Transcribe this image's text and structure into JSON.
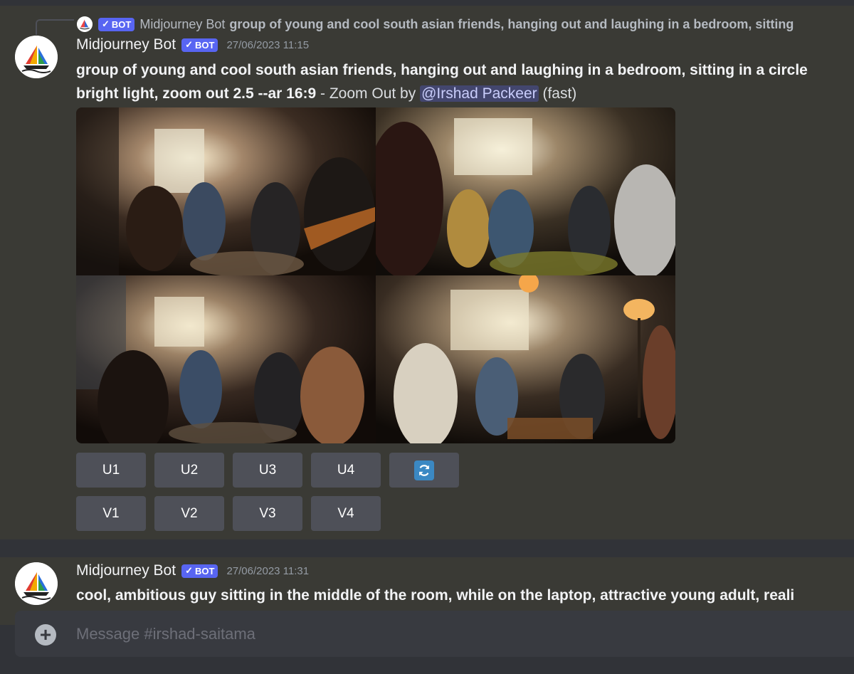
{
  "message1": {
    "reply_author": "Midjourney Bot",
    "reply_badge": "BOT",
    "reply_prompt": "group of young and cool south asian friends, hanging out and laughing in a bedroom, sitting",
    "author": "Midjourney Bot",
    "badge": "BOT",
    "timestamp": "27/06/2023 11:15",
    "prompt_line1": "group of young and cool south asian friends, hanging out and laughing in a bedroom, sitting in a circle",
    "prompt_line2": "bright light, zoom out 2.5 --ar 16:9",
    "suffix_text": " - Zoom Out by ",
    "mention": "@Irshad Packeer",
    "speed": " (fast)",
    "buttons_upscale": [
      "U1",
      "U2",
      "U3",
      "U4"
    ],
    "refresh_icon": "refresh-icon",
    "buttons_variation": [
      "V1",
      "V2",
      "V3",
      "V4"
    ]
  },
  "message2": {
    "author": "Midjourney Bot",
    "badge": "BOT",
    "timestamp": "27/06/2023 11:31",
    "prompt": "cool, ambitious guy sitting in the middle of the room, while on the laptop, attractive young adult, reali"
  },
  "composer": {
    "placeholder": "Message #irshad-saitama"
  },
  "colors": {
    "background": "#313338",
    "message_bg": "#3a3a35",
    "blurple": "#5865f2",
    "button": "#4e5058"
  }
}
